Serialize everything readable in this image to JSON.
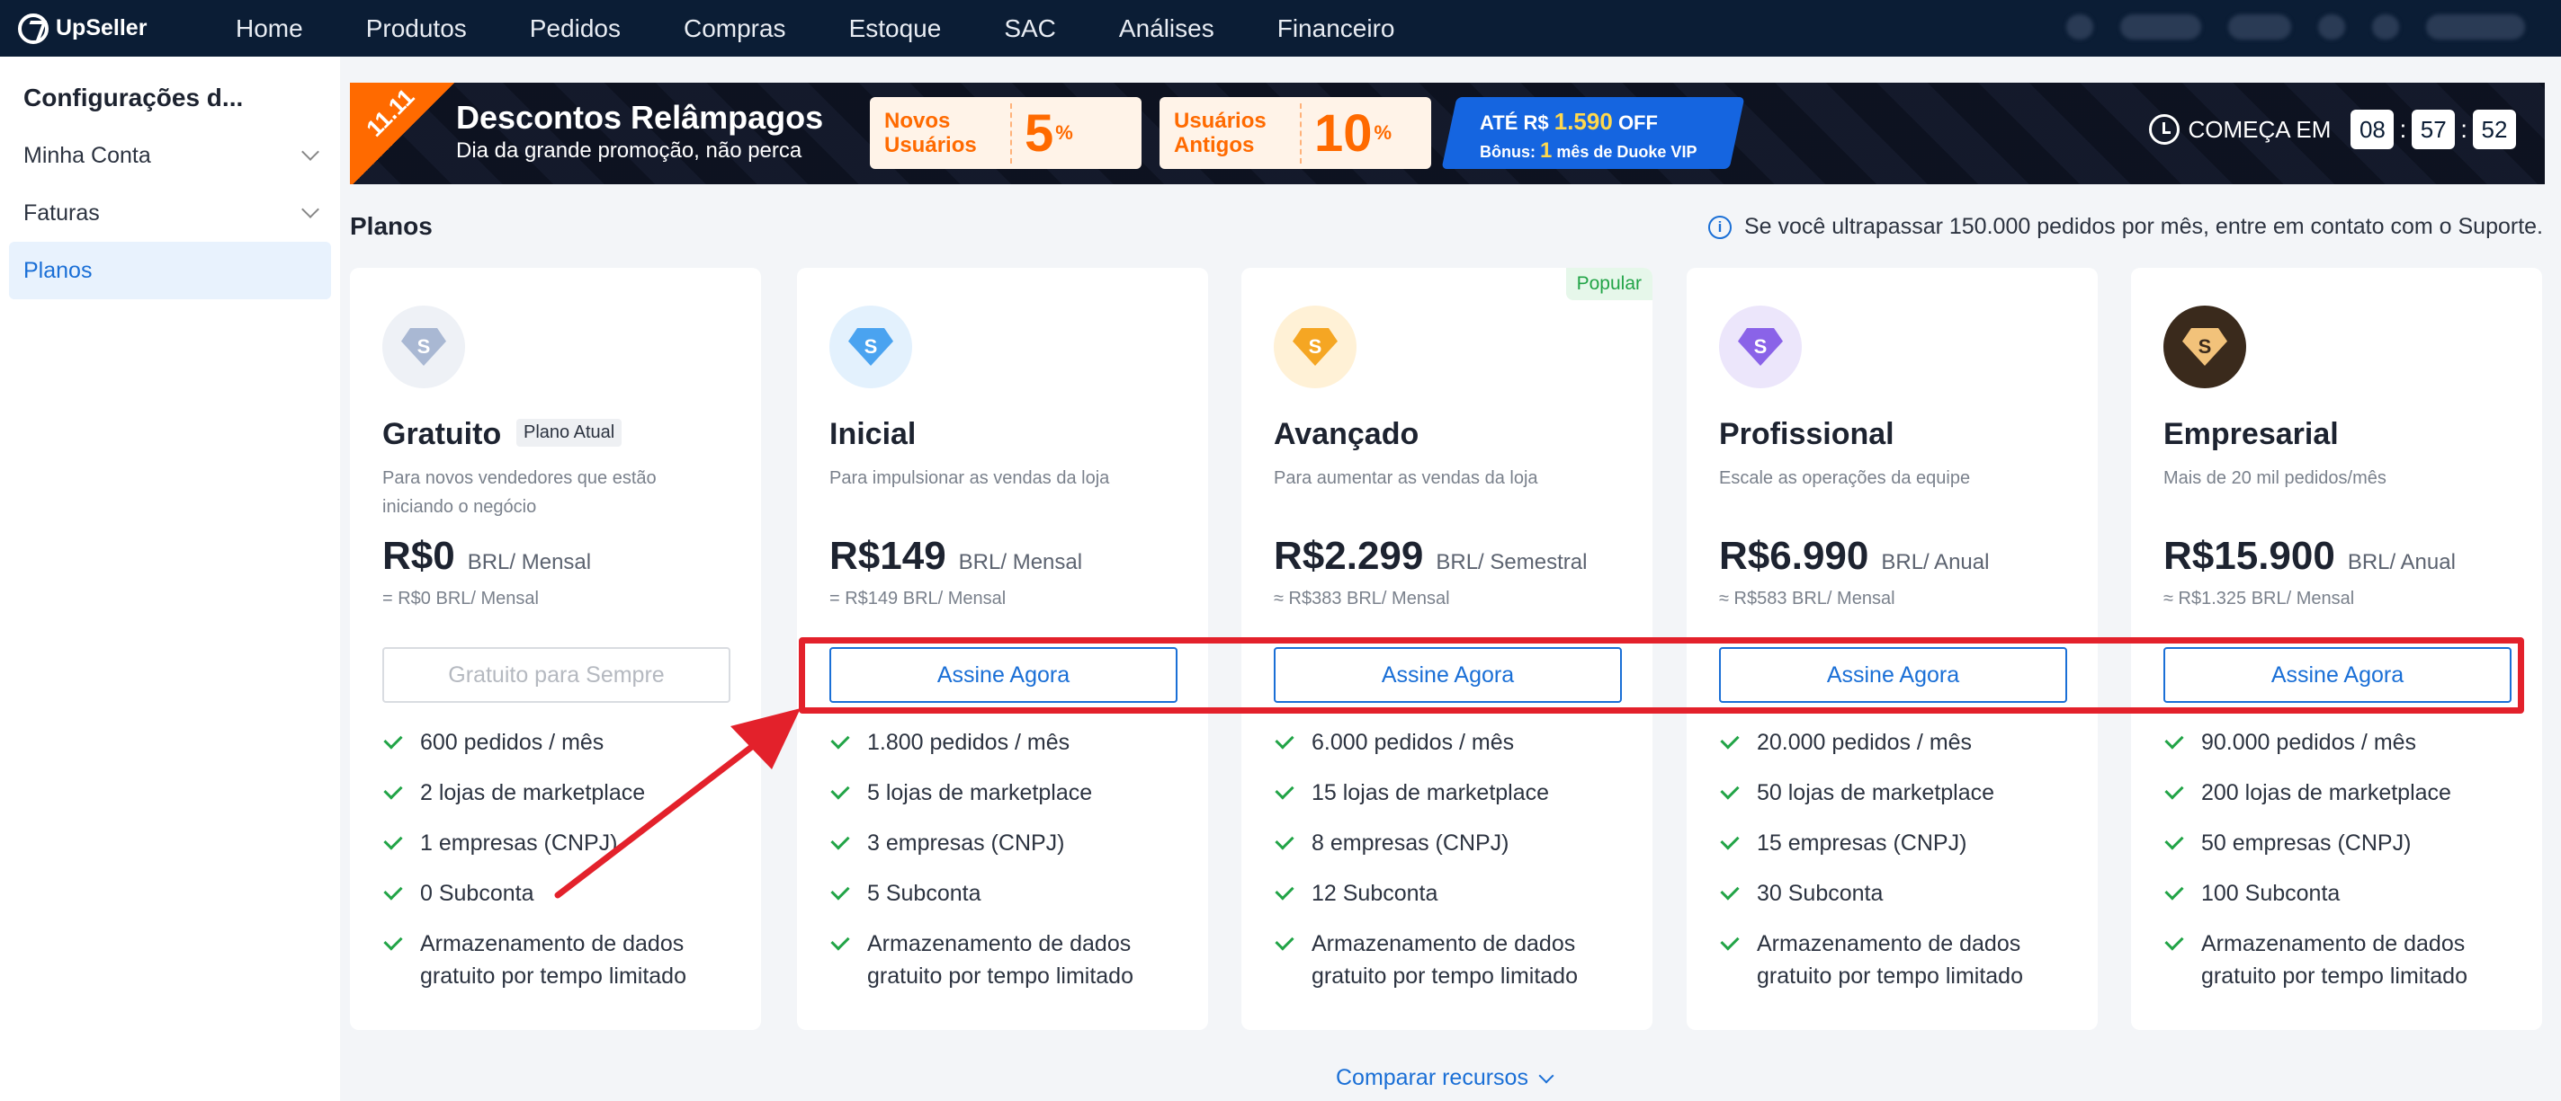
{
  "app": {
    "logo_text": "UpSeller",
    "nav": [
      "Home",
      "Produtos",
      "Pedidos",
      "Compras",
      "Estoque",
      "SAC",
      "Análises",
      "Financeiro"
    ]
  },
  "sidebar": {
    "title": "Configurações d...",
    "items": [
      {
        "label": "Minha Conta"
      },
      {
        "label": "Faturas"
      },
      {
        "label": "Planos"
      }
    ]
  },
  "banner": {
    "badge": "11.11",
    "title": "Descontos Relâmpagos",
    "subtitle": "Dia da grande promoção, não perca",
    "coupons": [
      {
        "label": "Novos Usuários",
        "value": "5",
        "pct": "%"
      },
      {
        "label": "Usuários Antigos",
        "value": "10",
        "pct": "%"
      }
    ],
    "promo_prefix": "ATÉ R$",
    "promo_amount": "1.590",
    "promo_suffix": "OFF",
    "bonus_prefix": "Bônus:",
    "bonus_count": "1",
    "bonus_suffix": "mês de Duoke VIP",
    "countdown_label": "COMEÇA EM",
    "countdown": [
      "08",
      "57",
      "52"
    ]
  },
  "plans": {
    "title": "Planos",
    "info": "Se você ultrapassar 150.000 pedidos por mês, entre em contato com o Suporte.",
    "compare": "Comparar recursos",
    "cards": [
      {
        "name": "Gratuito",
        "tag": "Plano Atual",
        "desc": "Para novos vendedores que estão iniciando o negócio",
        "price": "R$0",
        "unit": "BRL/ Mensal",
        "note": "= R$0 BRL/ Mensal",
        "button": "Gratuito para Sempre",
        "features": [
          "600 pedidos / mês",
          "2 lojas de marketplace",
          "1 empresas (CNPJ)",
          "0 Subconta",
          "Armazenamento de dados gratuito por tempo limitado"
        ]
      },
      {
        "name": "Inicial",
        "desc": "Para impulsionar as vendas da loja",
        "price": "R$149",
        "unit": "BRL/ Mensal",
        "note": "= R$149 BRL/ Mensal",
        "button": "Assine Agora",
        "features": [
          "1.800 pedidos / mês",
          "5 lojas de marketplace",
          "3 empresas (CNPJ)",
          "5 Subconta",
          "Armazenamento de dados gratuito por tempo limitado"
        ]
      },
      {
        "name": "Avançado",
        "badge": "Popular",
        "desc": "Para aumentar as vendas da loja",
        "price": "R$2.299",
        "unit": "BRL/ Semestral",
        "note": "≈ R$383 BRL/ Mensal",
        "button": "Assine Agora",
        "features": [
          "6.000 pedidos / mês",
          "15 lojas de marketplace",
          "8 empresas (CNPJ)",
          "12 Subconta",
          "Armazenamento de dados gratuito por tempo limitado"
        ]
      },
      {
        "name": "Profissional",
        "desc": "Escale as operações da equipe",
        "price": "R$6.990",
        "unit": "BRL/ Anual",
        "note": "≈ R$583 BRL/ Mensal",
        "button": "Assine Agora",
        "features": [
          "20.000 pedidos / mês",
          "50 lojas de marketplace",
          "15 empresas (CNPJ)",
          "30 Subconta",
          "Armazenamento de dados gratuito por tempo limitado"
        ]
      },
      {
        "name": "Empresarial",
        "desc": "Mais de 20 mil pedidos/mês",
        "price": "R$15.900",
        "unit": "BRL/ Anual",
        "note": "≈ R$1.325 BRL/ Mensal",
        "button": "Assine Agora",
        "features": [
          "90.000 pedidos / mês",
          "200 lojas de marketplace",
          "50 empresas (CNPJ)",
          "100 Subconta",
          "Armazenamento de dados gratuito por tempo limitado"
        ]
      }
    ]
  },
  "colors": {
    "nav_bg": "#0b1d35",
    "accent": "#1a6fd6",
    "check": "#22a447",
    "annotation": "#e3212b"
  }
}
